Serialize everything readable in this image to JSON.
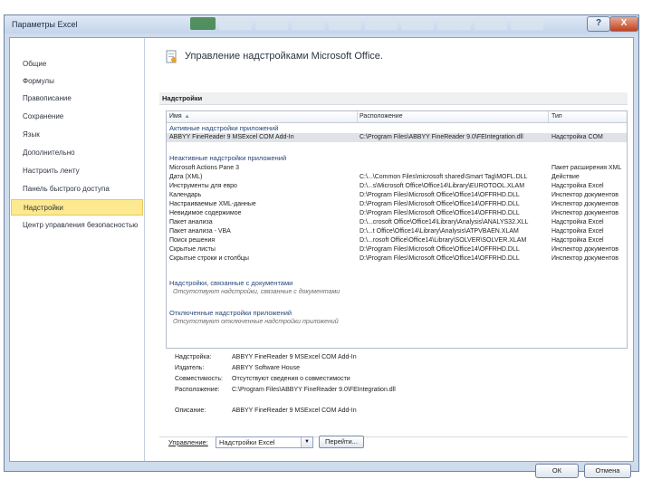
{
  "window": {
    "title": "Параметры Excel",
    "help_glyph": "?",
    "close_glyph": "X"
  },
  "nav": {
    "items": [
      {
        "label": "Общие"
      },
      {
        "label": "Формулы"
      },
      {
        "label": "Правописание"
      },
      {
        "label": "Сохранение"
      },
      {
        "label": "Язык"
      },
      {
        "label": "Дополнительно"
      },
      {
        "label": "Настроить ленту"
      },
      {
        "label": "Панель быстрого доступа"
      },
      {
        "label": "Надстройки"
      },
      {
        "label": "Центр управления безопасностью"
      }
    ],
    "selected_index": 8
  },
  "main": {
    "heading": "Управление надстройками Microsoft Office.",
    "section": "Надстройки",
    "columns": {
      "name": "Имя",
      "location": "Расположение",
      "type": "Тип"
    },
    "groups": {
      "active": "Активные надстройки приложений",
      "inactive": "Неактивные надстройки приложений",
      "document": "Надстройки, связанные с документами",
      "disabled": "Отключенные надстройки приложений"
    },
    "active_rows": [
      {
        "name": "ABBYY FineReader 9 MSExcel COM Add-In",
        "location": "C:\\Program Files\\ABBYY FineReader 9.0\\FEIntegration.dll",
        "type": "Надстройка COM"
      }
    ],
    "inactive_rows": [
      {
        "name": "Microsoft Actions Pane 3",
        "location": "",
        "type": "Пакет расширения XML"
      },
      {
        "name": "Дата (XML)",
        "location": "C:\\...\\Common Files\\microsoft shared\\Smart Tag\\MOFL.DLL",
        "type": "Действие"
      },
      {
        "name": "Инструменты для евро",
        "location": "D:\\...s\\Microsoft Office\\Office14\\Library\\EUROTOOL.XLAM",
        "type": "Надстройка Excel"
      },
      {
        "name": "Календарь",
        "location": "D:\\Program Files\\Microsoft Office\\Office14\\OFFRHD.DLL",
        "type": "Инспектор документов"
      },
      {
        "name": "Настраиваемые XML-данные",
        "location": "D:\\Program Files\\Microsoft Office\\Office14\\OFFRHD.DLL",
        "type": "Инспектор документов"
      },
      {
        "name": "Невидимое содержимое",
        "location": "D:\\Program Files\\Microsoft Office\\Office14\\OFFRHD.DLL",
        "type": "Инспектор документов"
      },
      {
        "name": "Пакет анализа",
        "location": "D:\\...crosoft Office\\Office14\\Library\\Analysis\\ANALYS32.XLL",
        "type": "Надстройка Excel"
      },
      {
        "name": "Пакет анализа - VBA",
        "location": "D:\\...t Office\\Office14\\Library\\Analysis\\ATPVBAEN.XLAM",
        "type": "Надстройка Excel"
      },
      {
        "name": "Поиск решения",
        "location": "D:\\...rosoft Office\\Office14\\Library\\SOLVER\\SOLVER.XLAM",
        "type": "Надстройка Excel"
      },
      {
        "name": "Скрытые листы",
        "location": "D:\\Program Files\\Microsoft Office\\Office14\\OFFRHD.DLL",
        "type": "Инспектор документов"
      },
      {
        "name": "Скрытые строки и столбцы",
        "location": "D:\\Program Files\\Microsoft Office\\Office14\\OFFRHD.DLL",
        "type": "Инспектор документов"
      }
    ],
    "document_empty": "Отсутствуют надстройки, связанные с документами",
    "disabled_empty": "Отсутствуют отключенные надстройки приложений",
    "details": [
      {
        "label": "Надстройка:",
        "value": "ABBYY FineReader 9 MSExcel COM Add-In"
      },
      {
        "label": "Издатель:",
        "value": "ABBYY Software House"
      },
      {
        "label": "Совместимость:",
        "value": "Отсутствуют сведения о совместимости"
      },
      {
        "label": "Расположение:",
        "value": "C:\\Program Files\\ABBYY FineReader 9.0\\FEIntegration.dll"
      },
      {
        "label": "Описание:",
        "value": "ABBYY FineReader 9 MSExcel COM Add-In"
      }
    ],
    "manage_label": "Управление:",
    "manage_value": "Надстройки Excel",
    "go_label": "Перейти..."
  },
  "buttons": {
    "ok": "ОК",
    "cancel": "Отмена"
  },
  "colors": {
    "selected_nav": "#fde98f",
    "close_button": "#c2411e",
    "group_heading": "#25467a"
  }
}
